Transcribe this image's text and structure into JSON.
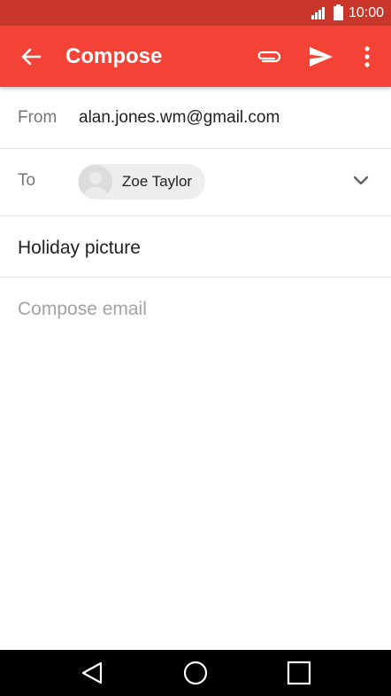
{
  "status_bar": {
    "time": "10:00",
    "signal_icon": "signal-icon",
    "battery_icon": "battery-icon"
  },
  "app_bar": {
    "title": "Compose",
    "back_icon": "back-arrow-icon",
    "attach_icon": "paperclip-icon",
    "send_icon": "send-icon",
    "more_icon": "more-vert-icon",
    "color": "#f44336"
  },
  "compose": {
    "from_label": "From",
    "from_value": "alan.jones.wm@gmail.com",
    "to_label": "To",
    "recipient_name": "Zoe Taylor",
    "subject": "Holiday picture",
    "body_placeholder": "Compose email"
  },
  "nav_bar": {
    "back_icon": "nav-back-icon",
    "home_icon": "nav-home-icon",
    "recents_icon": "nav-recents-icon"
  }
}
